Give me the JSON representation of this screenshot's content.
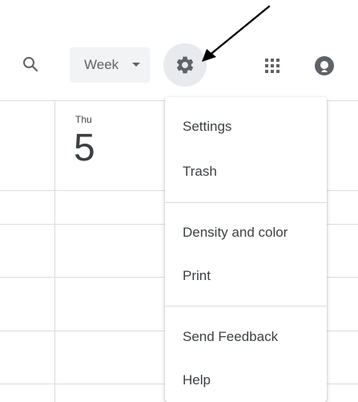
{
  "header": {
    "view_select": {
      "label": "Week"
    },
    "icons": {
      "search": "search-icon",
      "settings": "gear-icon",
      "apps": "apps-grid-icon",
      "account": "account-avatar-icon"
    }
  },
  "day": {
    "name": "Thu",
    "number": "5"
  },
  "menu": {
    "items": [
      {
        "label": "Settings"
      },
      {
        "label": "Trash"
      },
      {
        "label": "Density and color"
      },
      {
        "label": "Print"
      },
      {
        "label": "Send Feedback"
      },
      {
        "label": "Help"
      }
    ]
  },
  "colors": {
    "divider": "#dadce0",
    "select_bg": "#f1f3f4",
    "settings_bg": "#e8eaed",
    "icon": "#5f6368",
    "text": "#3c4043"
  }
}
